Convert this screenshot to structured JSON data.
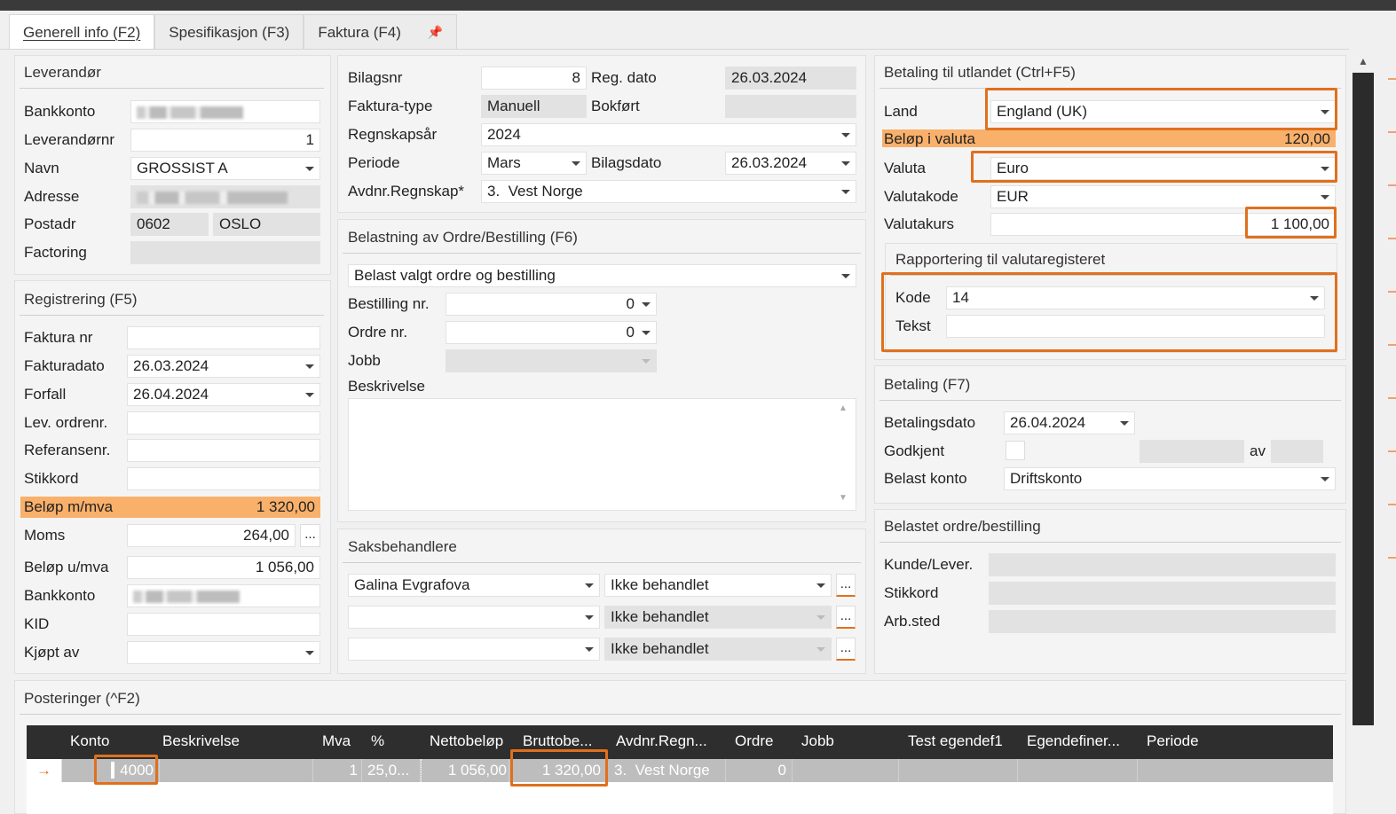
{
  "tabs": [
    "Generell info (F2)",
    "Spesifikasjon (F3)",
    "Faktura (F4)"
  ],
  "pin_icon": "pin-icon",
  "leverandor": {
    "title": "Leverandør",
    "bankkonto_label": "Bankkonto",
    "leverandornr_label": "Leverandørnr",
    "leverandornr": "1",
    "navn_label": "Navn",
    "navn": "GROSSIST A",
    "adresse_label": "Adresse",
    "postadr_label": "Postadr",
    "postnr": "0602",
    "poststed": "OSLO",
    "factoring_label": "Factoring"
  },
  "registrering": {
    "title": "Registrering (F5)",
    "faktura_nr_label": "Faktura nr",
    "faktura_nr": "",
    "fakturadato_label": "Fakturadato",
    "fakturadato": "26.03.2024",
    "forfall_label": "Forfall",
    "forfall": "26.04.2024",
    "lev_ordrenr_label": "Lev. ordrenr.",
    "referansenr_label": "Referansenr.",
    "stikkord_label": "Stikkord",
    "belop_mva_label": "Beløp m/mva",
    "belop_mva": "1 320,00",
    "moms_label": "Moms",
    "moms": "264,00",
    "moms_btn": "...",
    "belop_umva_label": "Beløp u/mva",
    "belop_umva": "1 056,00",
    "bankkonto_label": "Bankkonto",
    "kid_label": "KID",
    "kjopt_av_label": "Kjøpt av"
  },
  "bilag": {
    "bilagsnr_label": "Bilagsnr",
    "bilagsnr": "8",
    "reg_dato_label": "Reg. dato",
    "reg_dato": "26.03.2024",
    "fakturatype_label": "Faktura-type",
    "fakturatype": "Manuell",
    "bokfort_label": "Bokført",
    "regnskapsar_label": "Regnskapsår",
    "regnskapsar": "2024",
    "periode_label": "Periode",
    "periode": "Mars",
    "bilagsdato_label": "Bilagsdato",
    "bilagsdato": "26.03.2024",
    "avdnr_label": "Avdnr.Regnskap*",
    "avdnr": "3.  Vest Norge"
  },
  "belastning": {
    "title": "Belastning av Ordre/Bestilling (F6)",
    "valg": "Belast valgt ordre og bestilling",
    "bestilling_label": "Bestilling nr.",
    "bestilling": "0",
    "ordre_label": "Ordre nr.",
    "ordre": "0",
    "jobb_label": "Jobb",
    "beskrivelse_label": "Beskrivelse"
  },
  "saksbehandlere": {
    "title": "Saksbehandlere",
    "rows": [
      {
        "navn": "Galina Evgrafova",
        "status": "Ikke behandlet"
      },
      {
        "navn": "",
        "status": "Ikke behandlet"
      },
      {
        "navn": "",
        "status": "Ikke behandlet"
      }
    ],
    "btn": "..."
  },
  "utland": {
    "title": "Betaling til utlandet (Ctrl+F5)",
    "land_label": "Land",
    "land": "England (UK)",
    "belop_valuta_label": "Beløp i valuta",
    "belop_valuta": "120,00",
    "valuta_label": "Valuta",
    "valuta": "Euro",
    "valutakode_label": "Valutakode",
    "valutakode": "EUR",
    "valutakurs_label": "Valutakurs",
    "valutakurs": "1 100,00",
    "rapportering_title": "Rapportering til valutaregisteret",
    "kode_label": "Kode",
    "kode": "14",
    "tekst_label": "Tekst",
    "tekst": ""
  },
  "betaling": {
    "title": "Betaling (F7)",
    "betalingsdato_label": "Betalingsdato",
    "betalingsdato": "26.04.2024",
    "godkjent_label": "Godkjent",
    "av_label": "av",
    "belast_konto_label": "Belast konto",
    "belast_konto": "Driftskonto"
  },
  "belastet": {
    "title": "Belastet ordre/bestilling",
    "kunde_label": "Kunde/Lever.",
    "stikkord_label": "Stikkord",
    "arbsted_label": "Arb.sted"
  },
  "posteringer": {
    "title": "Posteringer (^F2)",
    "columns": [
      "Konto",
      "Beskrivelse",
      "Mva",
      "%",
      "Nettobeløp",
      "Bruttobe...",
      "Avdnr.Regn...",
      "Ordre",
      "Jobb",
      "Test egendef1",
      "Egendefiner...",
      "Periode"
    ],
    "row": {
      "arrow": "→",
      "konto": "4000",
      "beskrivelse": "",
      "mva": "1",
      "pct": "25,0...",
      "netto": "1 056,00",
      "brutto": "1 320,00",
      "avdnr": "3.  Vest Norge",
      "ordre": "0",
      "jobb": "",
      "test": "",
      "egendef": "",
      "periode": ""
    }
  },
  "colors": {
    "accent": "#e0701e",
    "highlight": "#f9b06a",
    "header_dark": "#2e2e2e"
  }
}
